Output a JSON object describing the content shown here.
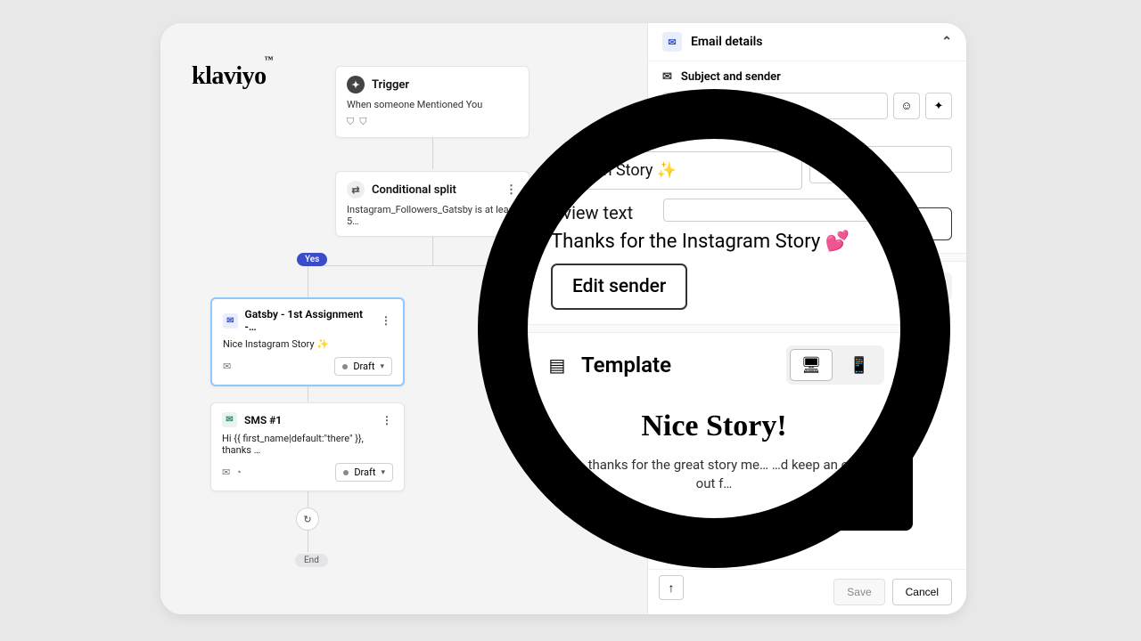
{
  "brand": "klaviyo",
  "flow": {
    "trigger": {
      "label": "Trigger",
      "desc": "When someone Mentioned You"
    },
    "split": {
      "label": "Conditional split",
      "desc": "Instagram_Followers_Gatsby is at least 5…"
    },
    "yes": "Yes",
    "email_card": {
      "title": "Gatsby - 1st Assignment -…",
      "subject": "Nice Instagram Story ✨",
      "status": "Draft"
    },
    "sms_card": {
      "title": "SMS #1",
      "body": "Hi {{ first_name|default:\"there\" }}, thanks …",
      "status": "Draft"
    },
    "end": "End"
  },
  "panel": {
    "email_details": "Email details",
    "subject_sender": "Subject and sender",
    "subject_value": "Nice Instagram Story ✨",
    "preview_label": "Preview text",
    "preview_value": "Thanks for the Instagram Story 💕",
    "edit_sender": "Edit sender",
    "template": "Template",
    "template_title": "Nice Story!",
    "template_body": "Hi , thanks for the great story mention — keep an eye out for…",
    "save": "Save",
    "cancel": "Cancel"
  },
  "magnifier": {
    "subject": "…gram Story ✨",
    "preview_label": "…view text",
    "preview_value": "Thanks for the Instagram Story 💕",
    "edit_sender": "Edit sender",
    "template": "Template",
    "template_title": "Nice Story!",
    "template_body": "…i , thanks for the great story me… …d keep an eye out f…"
  }
}
